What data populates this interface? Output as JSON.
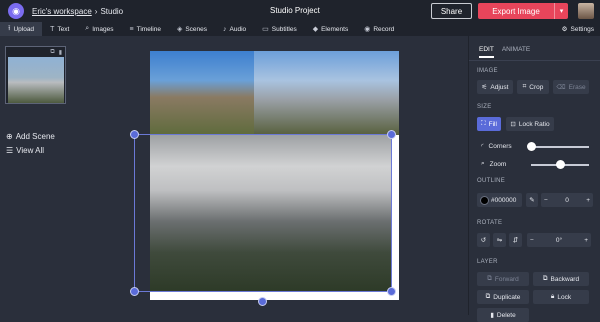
{
  "header": {
    "workspace": "Eric's workspace",
    "separator": "›",
    "section": "Studio",
    "project_title": "Studio Project",
    "share_label": "Share",
    "export_label": "Export Image",
    "export_chevron": "▾"
  },
  "toolbar": {
    "items": [
      {
        "label": "Upload",
        "icon": "upload-icon"
      },
      {
        "label": "Text",
        "icon": "text-icon"
      },
      {
        "label": "Images",
        "icon": "search-icon"
      },
      {
        "label": "Timeline",
        "icon": "timeline-icon"
      },
      {
        "label": "Scenes",
        "icon": "layers-icon"
      },
      {
        "label": "Audio",
        "icon": "music-icon"
      },
      {
        "label": "Subtitles",
        "icon": "subtitles-icon"
      },
      {
        "label": "Elements",
        "icon": "shapes-icon"
      },
      {
        "label": "Record",
        "icon": "record-icon"
      }
    ],
    "settings_label": "Settings"
  },
  "scenes": {
    "add_label": "Add Scene",
    "view_all_label": "View All"
  },
  "panel": {
    "tab_edit": "EDIT",
    "tab_animate": "ANIMATE",
    "image_heading": "IMAGE",
    "adjust": "Adjust",
    "crop": "Crop",
    "erase": "Erase",
    "size_heading": "SIZE",
    "fill": "Fill",
    "lock_ratio": "Lock Ratio",
    "corners": "Corners",
    "zoom": "Zoom",
    "corners_level": 0.0,
    "zoom_level": 0.5,
    "outline_heading": "OUTLINE",
    "outline_color": "#000000",
    "outline_width": "0",
    "rotate_heading": "ROTATE",
    "rotate_value": "0°",
    "layer_heading": "LAYER",
    "forward": "Forward",
    "backward": "Backward",
    "duplicate": "Duplicate",
    "lock": "Lock",
    "delete": "Delete"
  },
  "colors": {
    "accent": "#e8455b",
    "selection": "#5a6bd9",
    "background": "#2a2f3b",
    "topbar": "#1f232c"
  }
}
